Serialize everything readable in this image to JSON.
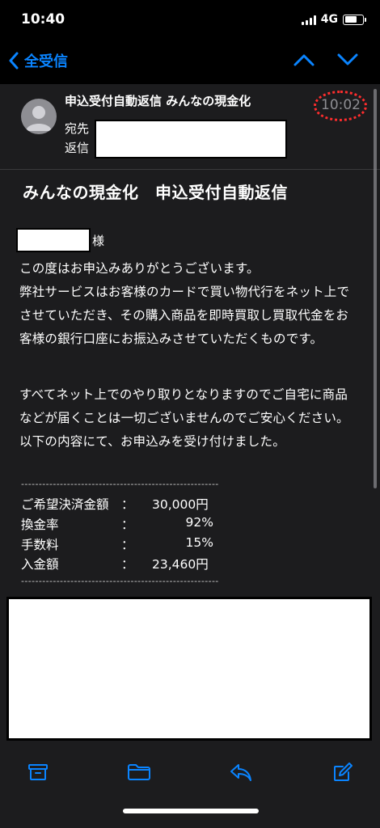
{
  "status_bar": {
    "time": "10:40",
    "network": "4G"
  },
  "nav": {
    "back_label": "全受信",
    "accent_color": "#0a84ff"
  },
  "header": {
    "subject": "申込受付自動返信 みんなの現金化",
    "time": "10:02",
    "to_label": "宛先",
    "from_label": "返信"
  },
  "body": {
    "title": "みんなの現金化　申込受付自動返信",
    "salutation_suffix": "様",
    "paragraph1": "この度はお申込みありがとうございます。\n弊社サービスはお客様のカードで買い物代行をネット上でさせていただき、その購入商品を即時買取し買取代金をお客様の銀行口座にお振込みさせていただくものです。",
    "paragraph2": "すべてネット上でのやり取りとなりますのでご自宅に商品などが届くことは一切ございませんのでご安心ください。\n以下の内容にて、お申込みを受け付けました。",
    "divider": "--------------------------------------------------------",
    "details": [
      {
        "label": "ご希望決済金額",
        "colon": "：",
        "value": "30,000円"
      },
      {
        "label": "換金率",
        "colon": "：",
        "value": "92%"
      },
      {
        "label": "手数料",
        "colon": "：",
        "value": "15%"
      },
      {
        "label": "入金額",
        "colon": "：",
        "value": "23,460円"
      }
    ]
  },
  "toolbar": {
    "icons": [
      "archive-icon",
      "folder-icon",
      "reply-icon",
      "compose-icon"
    ]
  },
  "colors": {
    "background": "#1c1c1e",
    "time_highlight": "#ff2d2d"
  }
}
